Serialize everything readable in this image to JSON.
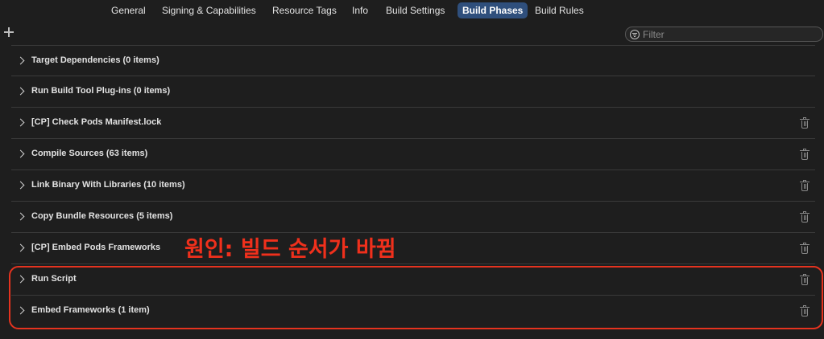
{
  "tabs": [
    {
      "label": "General",
      "active": false
    },
    {
      "label": "Signing & Capabilities",
      "active": false
    },
    {
      "label": "Resource Tags",
      "active": false
    },
    {
      "label": "Info",
      "active": false
    },
    {
      "label": "Build Settings",
      "active": false
    },
    {
      "label": "Build Phases",
      "active": true
    },
    {
      "label": "Build Rules",
      "active": false
    }
  ],
  "toolbar": {
    "add_icon": "plus-icon",
    "filter_placeholder": "Filter",
    "filter_icon": "filter-icon"
  },
  "phases": [
    {
      "label": "Target Dependencies (0 items)",
      "deletable": false
    },
    {
      "label": "Run Build Tool Plug-ins (0 items)",
      "deletable": false
    },
    {
      "label": "[CP] Check Pods Manifest.lock",
      "deletable": true
    },
    {
      "label": "Compile Sources (63 items)",
      "deletable": true
    },
    {
      "label": "Link Binary With Libraries (10 items)",
      "deletable": true
    },
    {
      "label": "Copy Bundle Resources (5 items)",
      "deletable": true
    },
    {
      "label": "[CP] Embed Pods Frameworks",
      "deletable": true
    },
    {
      "label": "Run Script",
      "deletable": true
    },
    {
      "label": "Embed Frameworks (1 item)",
      "deletable": true
    }
  ],
  "annotation": {
    "text": "원인: 빌드 순서가 바뀜",
    "color": "#f0301c"
  },
  "colors": {
    "background": "#1e1e1e",
    "active_tab": "#2f4f7c",
    "highlight_border": "#e5331f"
  }
}
